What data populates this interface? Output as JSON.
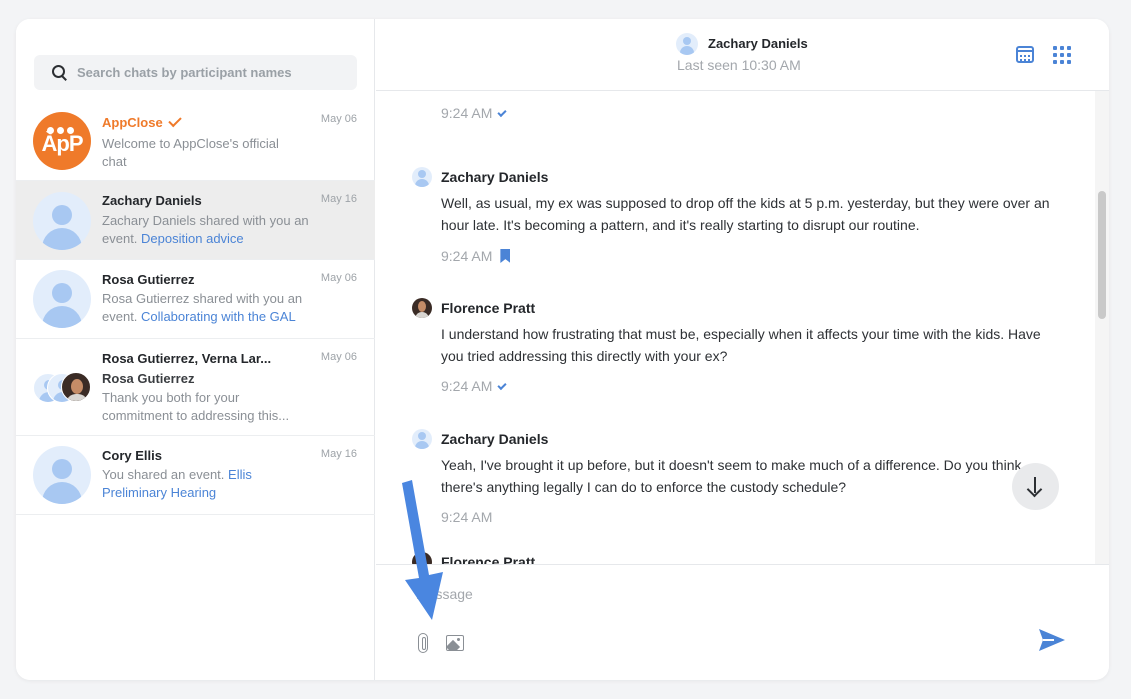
{
  "search": {
    "placeholder": "Search chats by participant names"
  },
  "chats": [
    {
      "name": "AppClose",
      "date": "May 06",
      "preview": "Welcome to AppClose's official chat",
      "brand_text": "ÀpP"
    },
    {
      "name": "Zachary Daniels",
      "date": "May 16",
      "preview": "Zachary Daniels shared with you an event.",
      "link": "Deposition advice"
    },
    {
      "name": "Rosa Gutierrez",
      "date": "May 06",
      "preview": "Rosa Gutierrez shared with you an event.",
      "link": "Collaborating with the GAL"
    },
    {
      "name": "Rosa Gutierrez, Verna Lar...",
      "date": "May 06",
      "sender": "Rosa Gutierrez",
      "preview": "Thank you both for your commitment to addressing this..."
    },
    {
      "name": "Cory Ellis",
      "date": "May 16",
      "preview": "You shared an event.",
      "link": "Ellis Preliminary Hearing"
    }
  ],
  "header": {
    "name": "Zachary Daniels",
    "status": "Last seen 10:30 AM"
  },
  "messages": [
    {
      "time": "9:24 AM",
      "status": "sent"
    },
    {
      "sender": "Zachary Daniels",
      "text": "Well, as usual, my ex was supposed to drop off the kids at 5 p.m. yesterday, but they were over an hour late. It's becoming a pattern, and it's really starting to disrupt our routine.",
      "time": "9:24 AM",
      "status": "bookmarked"
    },
    {
      "sender": "Florence Pratt",
      "text": "I understand how frustrating that must be, especially when it affects your time with the kids. Have you tried addressing this directly with your ex?",
      "time": "9:24 AM",
      "status": "sent"
    },
    {
      "sender": "Zachary Daniels",
      "text": "Yeah, I've brought it up before, but it doesn't seem to make much of a difference. Do you think there's anything legally I can do to enforce the custody schedule?",
      "time": "9:24 AM"
    },
    {
      "sender": "Florence Pratt"
    }
  ],
  "composer": {
    "placeholder": "Message"
  },
  "colors": {
    "accent": "#4b84d6",
    "brand": "#ef7a2a",
    "selected_row": "#ededed",
    "annotation_arrow": "#4a86e0"
  }
}
